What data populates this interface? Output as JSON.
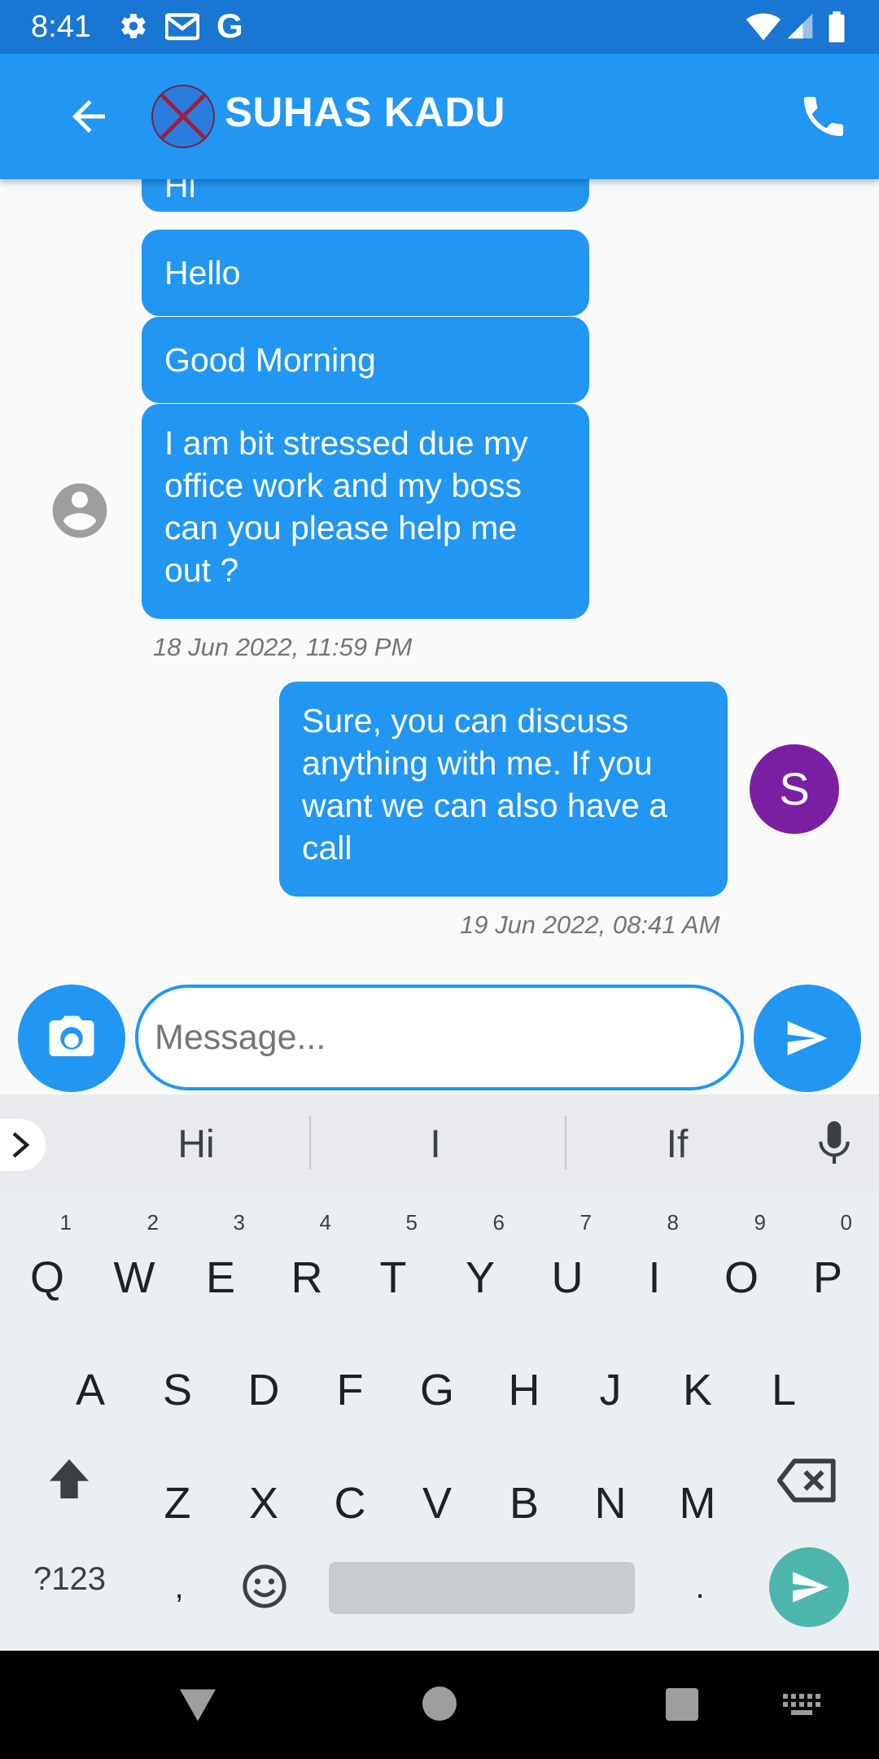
{
  "status_bar": {
    "time": "8:41",
    "icons": [
      "settings-icon",
      "gmail-icon",
      "google-icon",
      "wifi-icon",
      "signal-icon",
      "battery-icon"
    ]
  },
  "app_bar": {
    "contact_name": "SUHAS KADU",
    "icons": [
      "back-arrow-icon",
      "broken-avatar-icon",
      "phone-icon"
    ]
  },
  "chat": {
    "received": [
      {
        "text": "Hi"
      },
      {
        "text": "Hello"
      },
      {
        "text": "Good Morning"
      },
      {
        "text": "I am bit stressed due my office work and my boss can you please help me out ?"
      }
    ],
    "received_timestamp": "18 Jun 2022, 11:59 PM",
    "sent": [
      {
        "text": "Sure, you can discuss anything with me. If you want we can also have a call"
      }
    ],
    "sent_timestamp": "19 Jun 2022, 08:41 AM",
    "me_avatar_letter": "S"
  },
  "composer": {
    "placeholder": "Message...",
    "value": ""
  },
  "keyboard": {
    "suggestions": [
      "Hi",
      "I",
      "If"
    ],
    "row1": [
      {
        "key": "Q",
        "num": "1"
      },
      {
        "key": "W",
        "num": "2"
      },
      {
        "key": "E",
        "num": "3"
      },
      {
        "key": "R",
        "num": "4"
      },
      {
        "key": "T",
        "num": "5"
      },
      {
        "key": "Y",
        "num": "6"
      },
      {
        "key": "U",
        "num": "7"
      },
      {
        "key": "I",
        "num": "8"
      },
      {
        "key": "O",
        "num": "9"
      },
      {
        "key": "P",
        "num": "0"
      }
    ],
    "row2": [
      "A",
      "S",
      "D",
      "F",
      "G",
      "H",
      "J",
      "K",
      "L"
    ],
    "row3": [
      "Z",
      "X",
      "C",
      "V",
      "B",
      "N",
      "M"
    ],
    "symbols_label": "?123",
    "comma": ",",
    "period": "."
  },
  "colors": {
    "status_bar": "#1976d2",
    "app_bar": "#2196f3",
    "bubble": "#2196f3",
    "avatar_me": "#7b1fa2",
    "keyboard_action": "#4db6ac"
  }
}
